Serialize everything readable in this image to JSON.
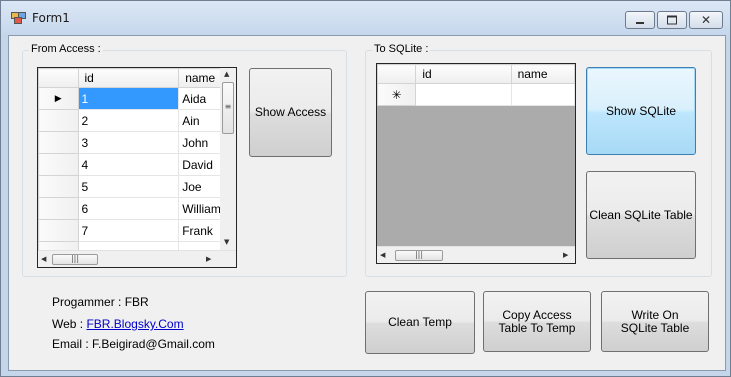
{
  "window": {
    "title": "Form1"
  },
  "access_group": {
    "label": "From Access :",
    "columns": [
      "id",
      "name"
    ],
    "rows": [
      {
        "id": "1",
        "name": "Aida"
      },
      {
        "id": "2",
        "name": "Ain"
      },
      {
        "id": "3",
        "name": "John"
      },
      {
        "id": "4",
        "name": "David"
      },
      {
        "id": "5",
        "name": "Joe"
      },
      {
        "id": "6",
        "name": "William"
      },
      {
        "id": "7",
        "name": "Frank"
      }
    ],
    "current_row_glyph": "▶",
    "show_button": "Show Access"
  },
  "sqlite_group": {
    "label": "To SQLite :",
    "columns": [
      "id",
      "name"
    ],
    "new_row_glyph": "✳",
    "show_button": "Show SQLite",
    "clean_button": "Clean SQLite Table"
  },
  "actions": {
    "clean_temp": "Clean Temp",
    "copy_access": "Copy Access Table To Temp",
    "write_sqlite": "Write On SQLite Table"
  },
  "info": {
    "programmer_label": "Progammer :",
    "programmer_name": "FBR",
    "web_label": "Web :",
    "web_link": "FBR.Blogsky.Com",
    "email_label": "Email :",
    "email_value": "F.Beigirad@Gmail.com"
  }
}
